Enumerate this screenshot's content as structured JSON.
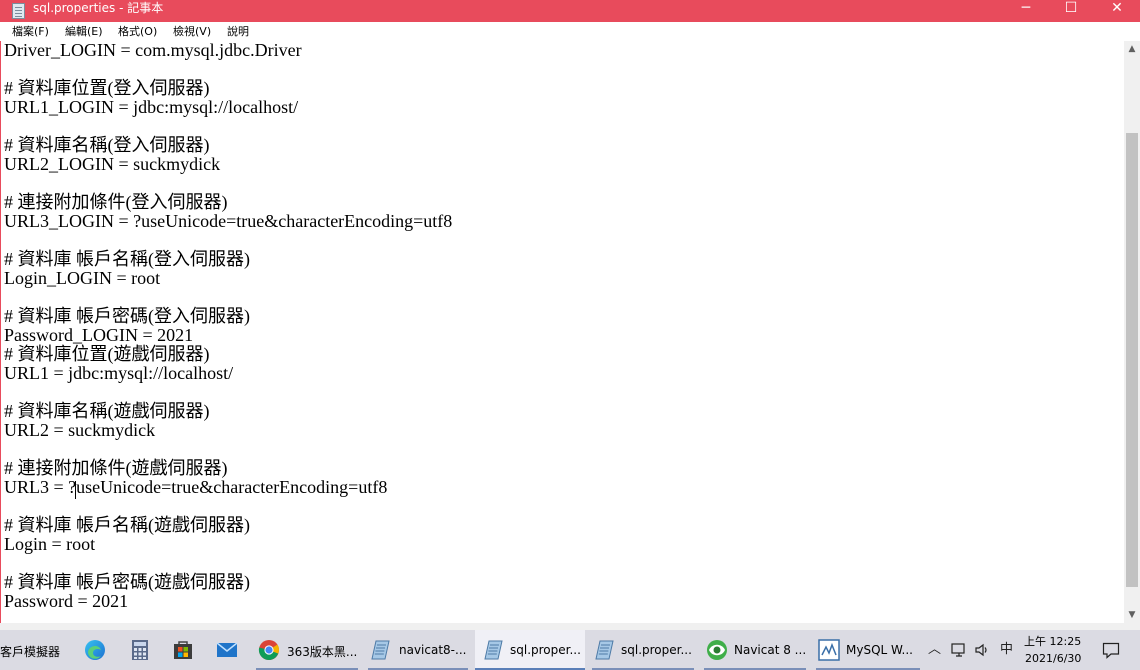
{
  "window": {
    "title": "sql.properties - 記事本",
    "minimize_glyph": "─",
    "maximize_glyph": "☐",
    "close_glyph": "✕"
  },
  "menu": [
    "檔案(F)",
    "編輯(E)",
    "格式(O)",
    "檢視(V)",
    "說明"
  ],
  "editor": {
    "lines": [
      "Driver_LOGIN = com.mysql.jdbc.Driver",
      "",
      "# 資料庫位置(登入伺服器)",
      "URL1_LOGIN = jdbc:mysql://localhost/",
      "",
      "# 資料庫名稱(登入伺服器)",
      "URL2_LOGIN = suckmydick",
      "",
      "# 連接附加條件(登入伺服器)",
      "URL3_LOGIN = ?useUnicode=true&characterEncoding=utf8",
      "",
      "# 資料庫 帳戶名稱(登入伺服器)",
      "Login_LOGIN = root",
      "",
      "# 資料庫 帳戶密碼(登入伺服器)",
      "Password_LOGIN = 2021",
      "# 資料庫位置(遊戲伺服器)",
      "URL1 = jdbc:mysql://localhost/",
      "",
      "# 資料庫名稱(遊戲伺服器)",
      "URL2 = suckmydick",
      "",
      "# 連接附加條件(遊戲伺服器)",
      "URL3 = ?useUnicode=true&characterEncoding=utf8",
      "",
      "# 資料庫 帳戶名稱(遊戲伺服器)",
      "Login = root",
      "",
      "# 資料庫 帳戶密碼(遊戲伺服器)",
      "Password = 2021"
    ]
  },
  "scrollbar": {
    "up_glyph": "▲",
    "down_glyph": "▼"
  },
  "taskbar": {
    "left_label": "客戶模擬器",
    "items": [
      {
        "label": "363版本黑..."
      },
      {
        "label": "navicat8-..."
      },
      {
        "label": "sql.proper..."
      },
      {
        "label": "sql.proper..."
      },
      {
        "label": "Navicat 8 ..."
      },
      {
        "label": "MySQL W..."
      }
    ],
    "tray": {
      "chevron": "︿",
      "ime": "中",
      "time": "上午 12:25",
      "date": "2021/6/30"
    }
  },
  "colors": {
    "titlebar": "#e84b5c",
    "taskbar": "#dbdbe3",
    "accent": "#5a7fb8"
  }
}
